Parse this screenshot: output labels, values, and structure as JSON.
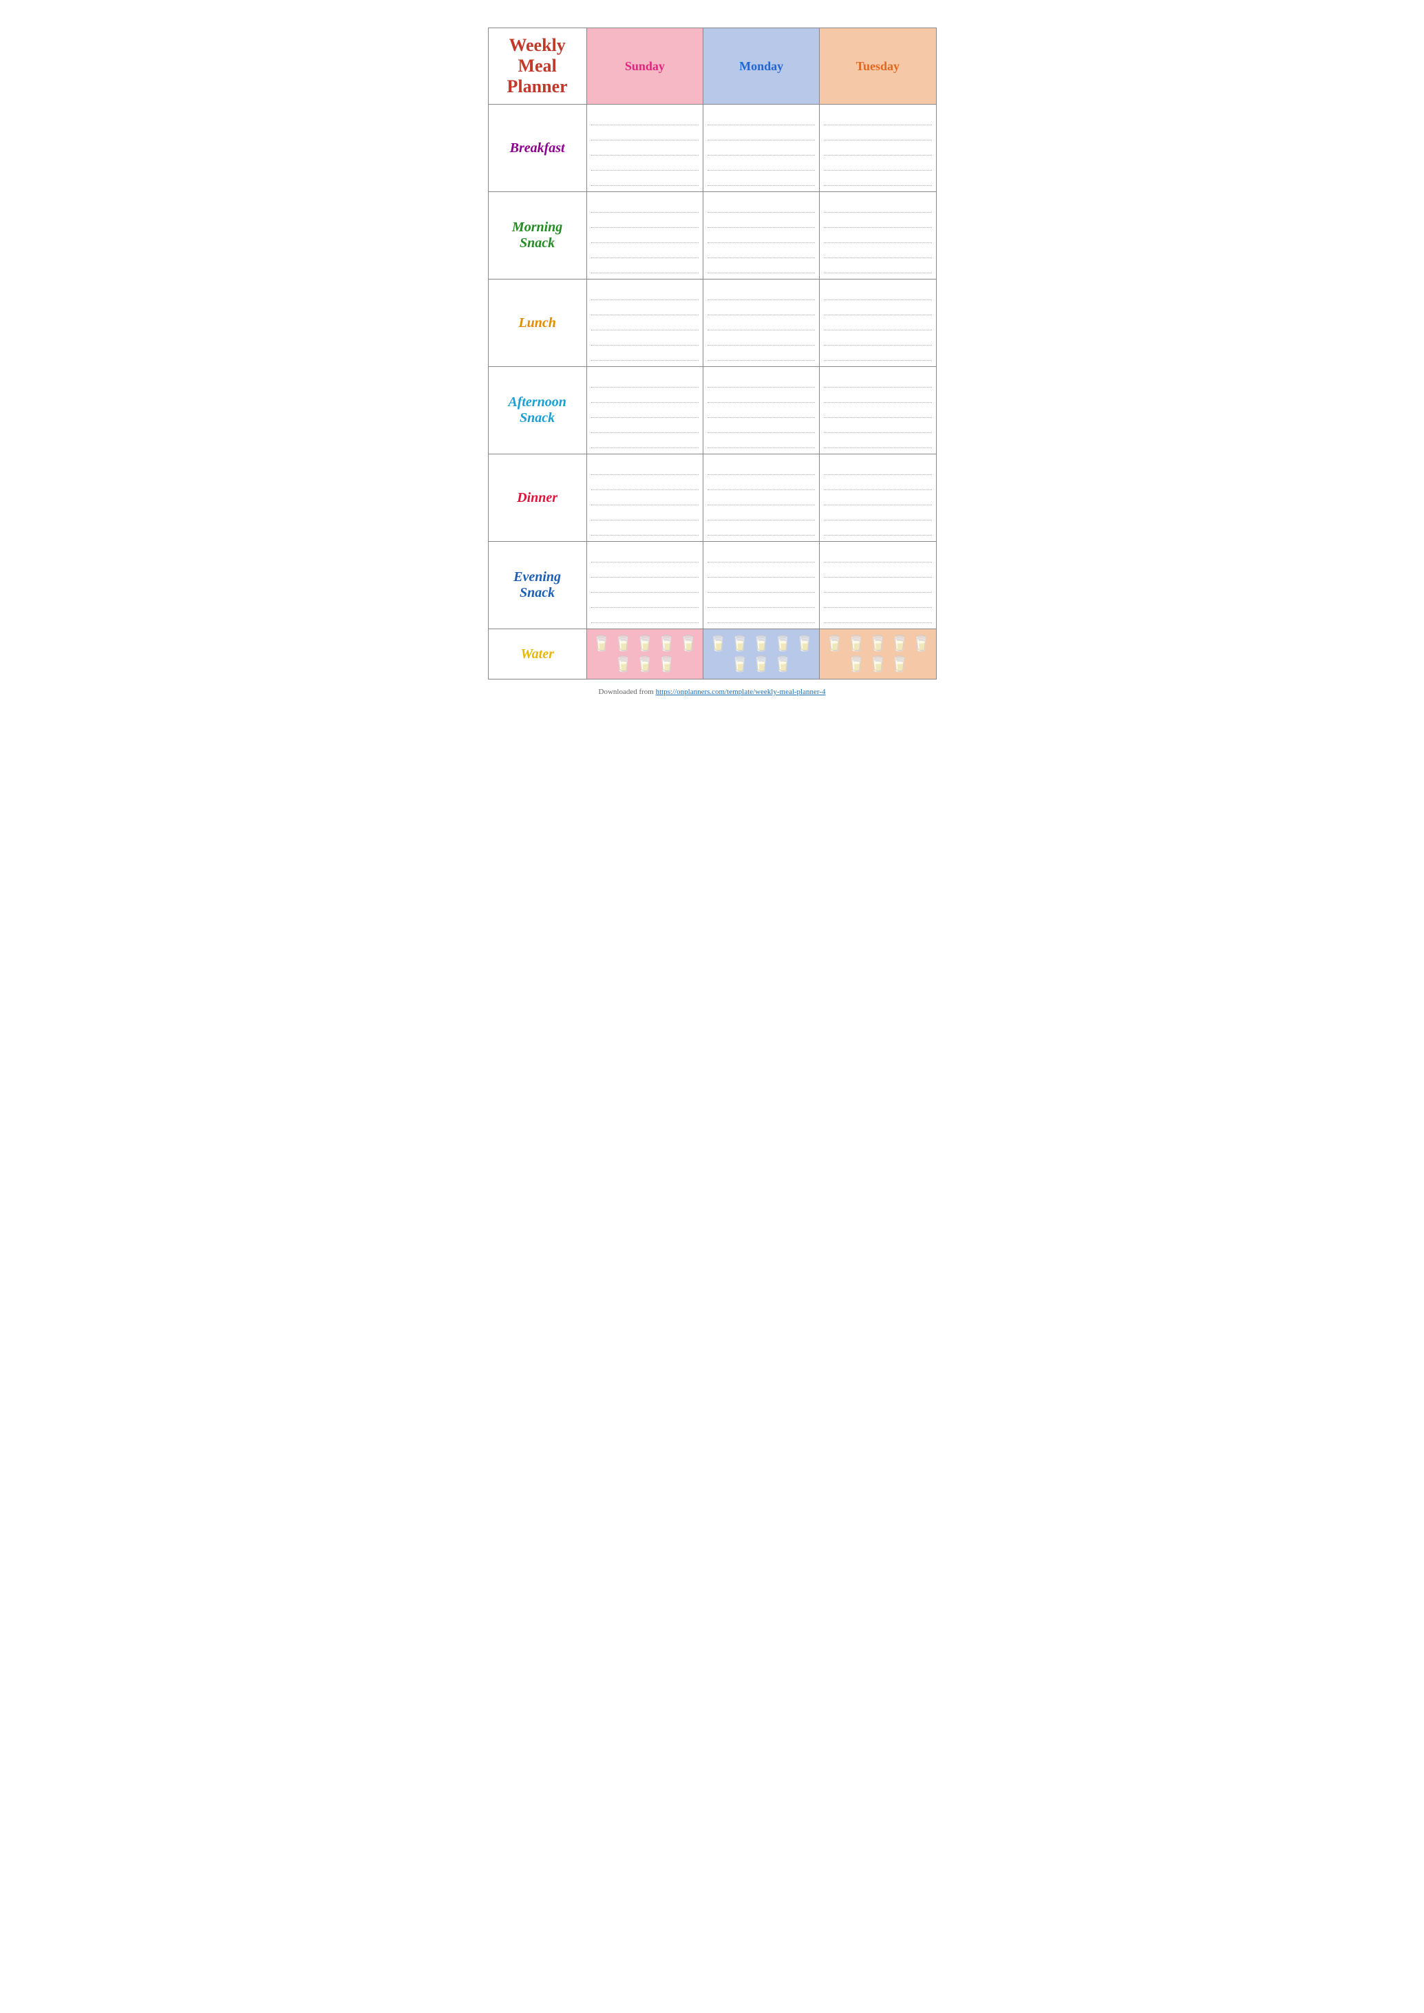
{
  "title": {
    "line1": "Weekly",
    "line2": "Meal Planner"
  },
  "days": [
    {
      "name": "Sunday",
      "color_class": "sunday-text",
      "header_class": "sunday-header"
    },
    {
      "name": "Monday",
      "color_class": "monday-text",
      "header_class": "monday-header"
    },
    {
      "name": "Tuesday",
      "color_class": "tuesday-text",
      "header_class": "tuesday-header"
    }
  ],
  "meals": [
    {
      "label": "Breakfast",
      "color_class": "label-breakfast",
      "lines": 5
    },
    {
      "label": "Morning\nSnack",
      "color_class": "label-morning-snack",
      "lines": 5
    },
    {
      "label": "Lunch",
      "color_class": "label-lunch",
      "lines": 5
    },
    {
      "label": "Afternoon\nSnack",
      "color_class": "label-afternoon-snack",
      "lines": 5
    },
    {
      "label": "Dinner",
      "color_class": "label-dinner",
      "lines": 5
    },
    {
      "label": "Evening\nSnack",
      "color_class": "label-evening-snack",
      "lines": 5
    }
  ],
  "water": {
    "label": "Water",
    "glasses_count": 8,
    "glass_icon": "🥛"
  },
  "footer": {
    "text": "Downloaded from ",
    "link_text": "https://onplanners.com/template/weekly-meal-planner-4",
    "link_url": "https://onplanners.com/template/weekly-meal-planner-4"
  }
}
